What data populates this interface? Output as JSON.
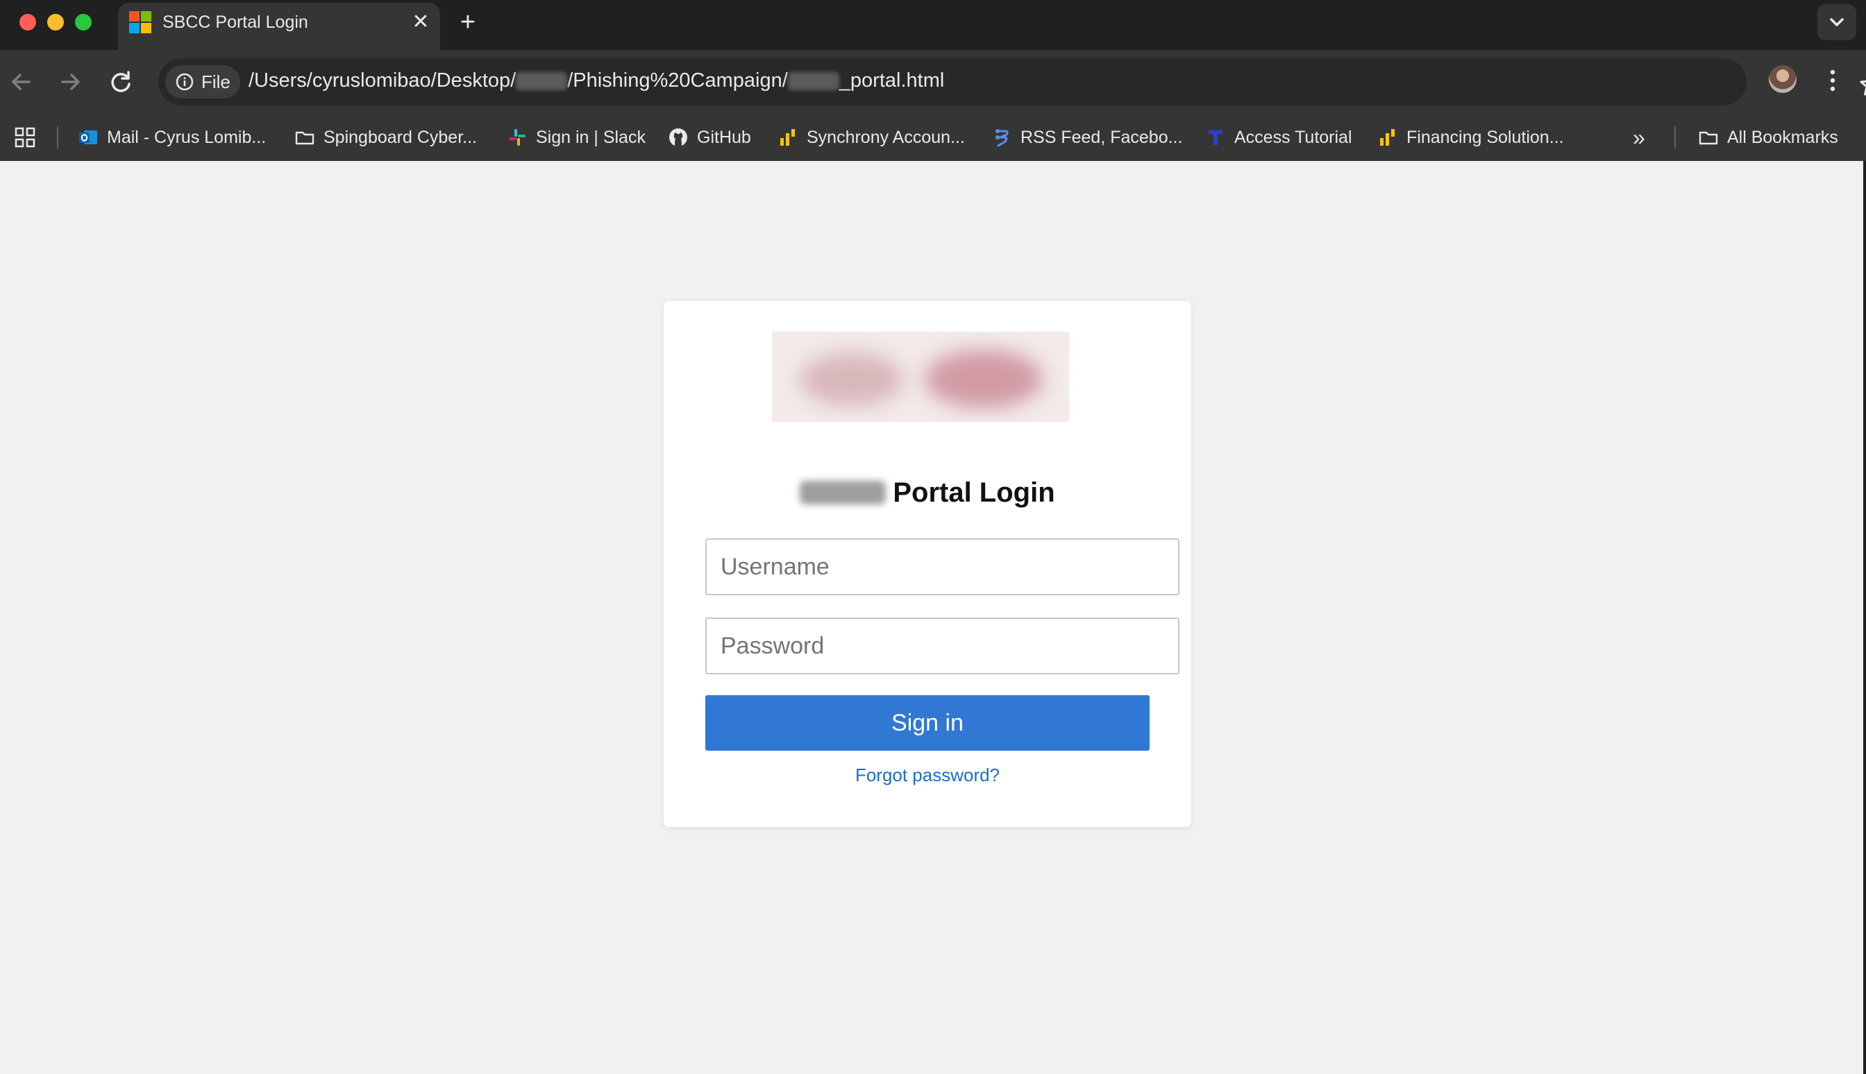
{
  "browser": {
    "tab": {
      "title": "SBCC Portal Login",
      "close_glyph": "✕"
    },
    "new_tab_glyph": "+",
    "omnibox": {
      "site_chip_label": "File",
      "url_part1": "/Users/cyruslomibao/Desktop/",
      "url_part2": "/Phishing%20Campaign/",
      "url_part3": "_portal.html"
    },
    "bookmarks": [
      {
        "label": "Mail - Cyrus Lomib...",
        "icon": "outlook-icon"
      },
      {
        "label": "Spingboard Cyber...",
        "icon": "folder-icon"
      },
      {
        "label": "Sign in | Slack",
        "icon": "slack-icon"
      },
      {
        "label": "GitHub",
        "icon": "github-icon"
      },
      {
        "label": "Synchrony Accoun...",
        "icon": "synchrony-icon"
      },
      {
        "label": "RSS Feed, Facebo...",
        "icon": "rss-app-icon"
      },
      {
        "label": "Access Tutorial",
        "icon": "tutorial-icon"
      },
      {
        "label": "Financing Solution...",
        "icon": "synchrony-icon"
      }
    ],
    "overflow_glyph": "»",
    "all_bookmarks_label": "All Bookmarks"
  },
  "login": {
    "title_suffix": "Portal Login",
    "username_placeholder": "Username",
    "password_placeholder": "Password",
    "signin_label": "Sign in",
    "forgot_label": "Forgot password?"
  },
  "colors": {
    "primary_button": "#3078d3",
    "link": "#1a6fcc",
    "page_background": "#f2f1ef"
  }
}
